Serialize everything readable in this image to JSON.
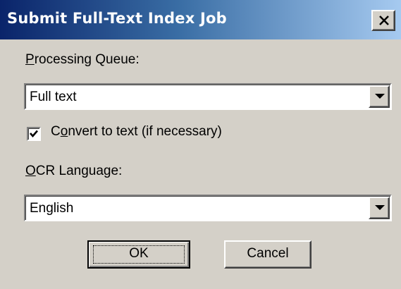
{
  "window": {
    "title": "Submit Full-Text Index Job",
    "close_icon": "close-icon"
  },
  "queue": {
    "label_mnemonic": "P",
    "label_rest": "rocessing Queue:",
    "value": "Full text"
  },
  "convert": {
    "checked": true,
    "label_first": "C",
    "label_mnemonic": "o",
    "label_rest": "nvert to text (if necessary)"
  },
  "ocr": {
    "label_mnemonic": "O",
    "label_rest": "CR Language:",
    "value": "English"
  },
  "buttons": {
    "ok": "OK",
    "cancel": "Cancel"
  },
  "colors": {
    "title_bar_start": "#0a246a",
    "title_bar_end": "#a6caf0",
    "face": "#d4d0c8"
  }
}
